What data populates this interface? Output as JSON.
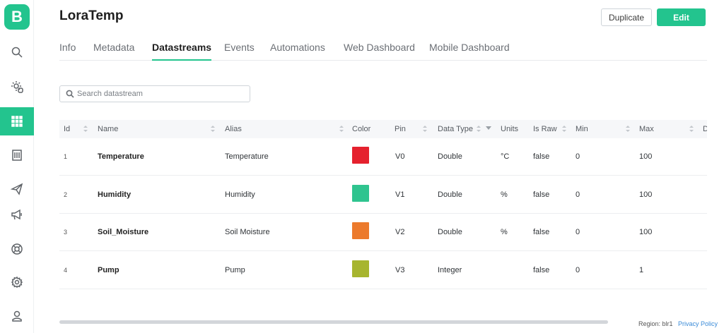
{
  "app": {
    "logo_letter": "B",
    "brand_color": "#23c48e"
  },
  "sidebar": {
    "items": [
      {
        "icon": "search-icon"
      },
      {
        "icon": "sun-bug-icon"
      },
      {
        "icon": "grid-icon",
        "active": true
      },
      {
        "icon": "building-icon"
      },
      {
        "icon": "paper-plane-icon"
      },
      {
        "icon": "megaphone-icon"
      },
      {
        "icon": "lifebuoy-icon"
      },
      {
        "icon": "gear-icon"
      },
      {
        "icon": "user-icon"
      }
    ]
  },
  "header": {
    "title": "LoraTemp",
    "duplicate_label": "Duplicate",
    "edit_label": "Edit"
  },
  "tabs": [
    {
      "label": "Info"
    },
    {
      "label": "Metadata"
    },
    {
      "label": "Datastreams",
      "active": true
    },
    {
      "label": "Events"
    },
    {
      "label": "Automations"
    },
    {
      "label": "Web Dashboard"
    },
    {
      "label": "Mobile Dashboard"
    }
  ],
  "search": {
    "placeholder": "Search datastream",
    "value": ""
  },
  "table": {
    "columns": [
      "Id",
      "Name",
      "Alias",
      "Color",
      "Pin",
      "Data Type",
      "Units",
      "Is Raw",
      "Min",
      "Max",
      "D"
    ],
    "rows": [
      {
        "id": "1",
        "name": "Temperature",
        "alias": "Temperature",
        "color": "#e5212e",
        "pin": "V0",
        "data_type": "Double",
        "units": "°C",
        "is_raw": "false",
        "min": "0",
        "max": "100"
      },
      {
        "id": "2",
        "name": "Humidity",
        "alias": "Humidity",
        "color": "#2fc48f",
        "pin": "V1",
        "data_type": "Double",
        "units": "%",
        "is_raw": "false",
        "min": "0",
        "max": "100"
      },
      {
        "id": "3",
        "name": "Soil_Moisture",
        "alias": "Soil Moisture",
        "color": "#ec7a2c",
        "pin": "V2",
        "data_type": "Double",
        "units": "%",
        "is_raw": "false",
        "min": "0",
        "max": "100"
      },
      {
        "id": "4",
        "name": "Pump",
        "alias": "Pump",
        "color": "#a7b52f",
        "pin": "V3",
        "data_type": "Integer",
        "units": "",
        "is_raw": "false",
        "min": "0",
        "max": "1"
      }
    ]
  },
  "footer": {
    "region": "Region: blr1",
    "privacy": "Privacy Policy"
  }
}
